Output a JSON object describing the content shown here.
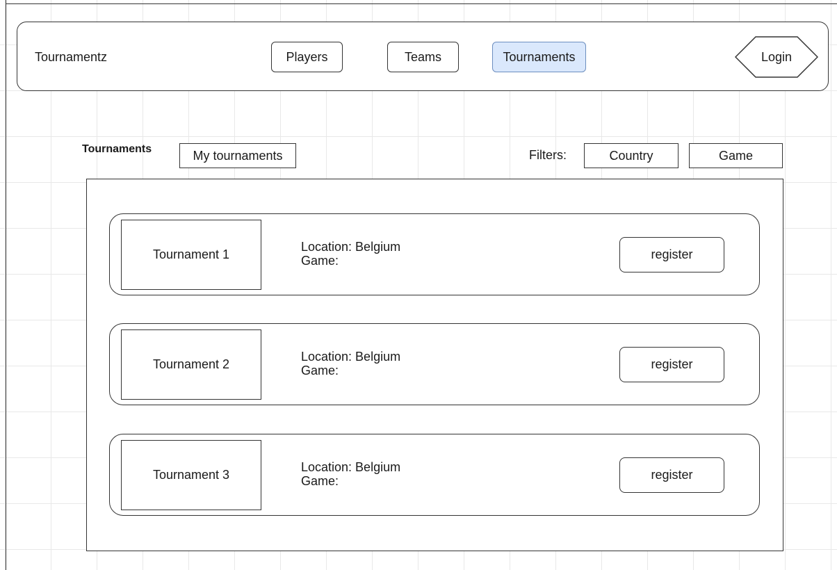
{
  "header": {
    "brand": "Tournamentz",
    "nav": [
      {
        "label": "Players",
        "active": false
      },
      {
        "label": "Teams",
        "active": false
      },
      {
        "label": "Tournaments",
        "active": true
      }
    ],
    "login_label": "Login"
  },
  "toolbar": {
    "title": "Tournaments",
    "my_tournaments_label": "My tournaments",
    "filters_label": "Filters:",
    "filter_country_label": "Country",
    "filter_game_label": "Game"
  },
  "tournaments": [
    {
      "name": "Tournament 1",
      "location": "Location: Belgium",
      "game": "Game:",
      "action_label": "register"
    },
    {
      "name": "Tournament 2",
      "location": "Location: Belgium",
      "game": "Game:",
      "action_label": "register"
    },
    {
      "name": "Tournament 3",
      "location": "Location: Belgium",
      "game": "Game:",
      "action_label": "register"
    }
  ],
  "colors": {
    "active_nav_fill": "#dae8fc",
    "active_nav_stroke": "#6c8ebf",
    "stroke": "#333333"
  },
  "icons": {
    "login_shape": "hexagon"
  }
}
